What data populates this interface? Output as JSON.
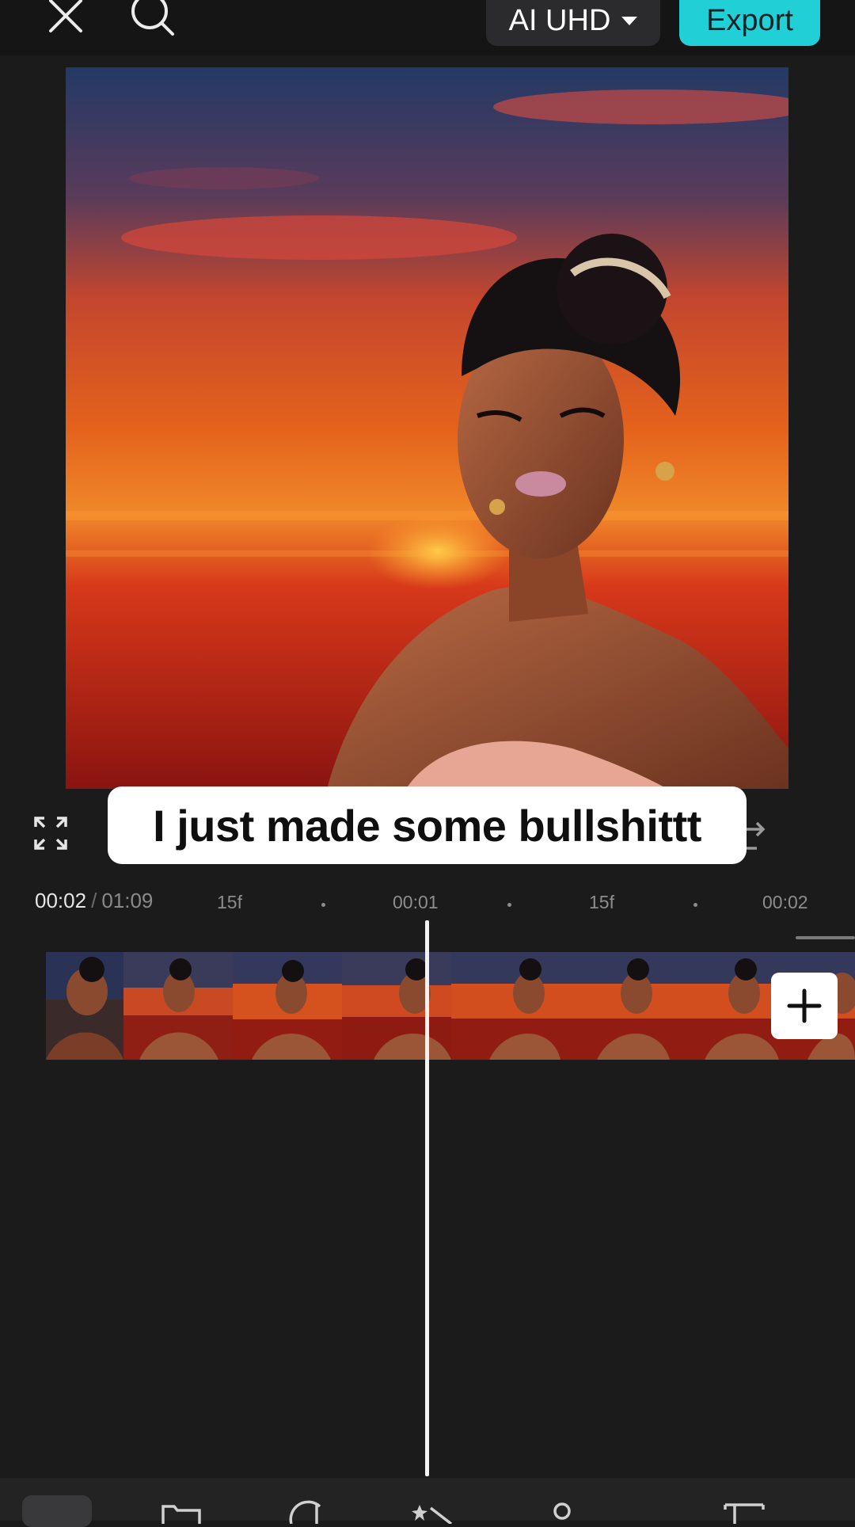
{
  "topbar": {
    "close_icon": "close-icon",
    "search_icon": "search-icon",
    "quality_label": "AI UHD",
    "export_label": "Export"
  },
  "preview": {
    "caption": "I just made some bullshittt"
  },
  "timeline": {
    "current_time": "00:02",
    "separator": "/",
    "total_time": "01:09",
    "ruler_labels": [
      "15f",
      "00:01",
      "15f",
      "00:02"
    ]
  },
  "track": {
    "add_icon": "plus-icon"
  },
  "colors": {
    "accent": "#20d0d6",
    "background": "#1b1b1c"
  }
}
